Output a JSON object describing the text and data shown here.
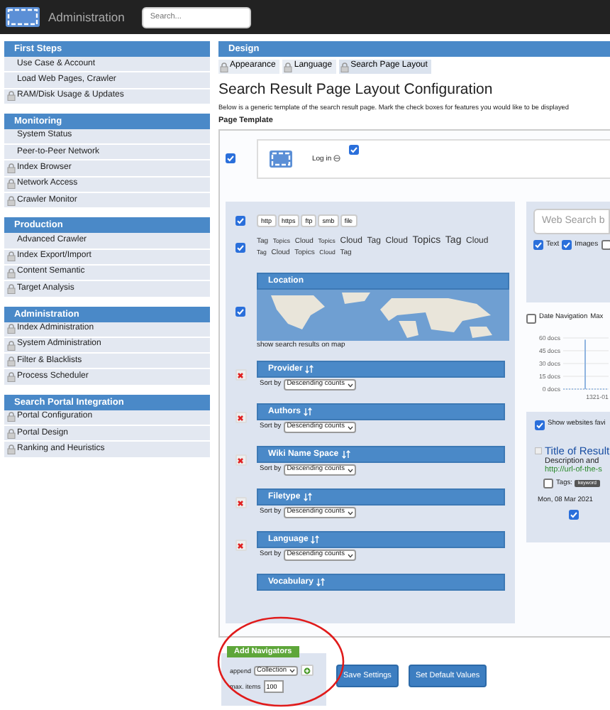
{
  "navbar": {
    "title": "Administration",
    "search": {
      "placeholder": "Search..."
    }
  },
  "sidebar": {
    "groups": [
      {
        "title": "First Steps",
        "items": [
          {
            "label": "Use Case & Account",
            "locked": false
          },
          {
            "label": "Load Web Pages, Crawler",
            "locked": false
          },
          {
            "label": "RAM/Disk Usage & Updates",
            "locked": true
          }
        ]
      },
      {
        "title": "Monitoring",
        "items": [
          {
            "label": "System Status",
            "locked": false
          },
          {
            "label": "Peer-to-Peer Network",
            "locked": false
          },
          {
            "label": "Index Browser",
            "locked": true
          },
          {
            "label": "Network Access",
            "locked": true
          },
          {
            "label": "Crawler Monitor",
            "locked": true
          }
        ]
      },
      {
        "title": "Production",
        "items": [
          {
            "label": "Advanced Crawler",
            "locked": false
          },
          {
            "label": "Index Export/Import",
            "locked": true
          },
          {
            "label": "Content Semantic",
            "locked": true
          },
          {
            "label": "Target Analysis",
            "locked": true
          }
        ]
      },
      {
        "title": "Administration",
        "items": [
          {
            "label": "Index Administration",
            "locked": true
          },
          {
            "label": "System Administration",
            "locked": true
          },
          {
            "label": "Filter & Blacklists",
            "locked": true
          },
          {
            "label": "Process Scheduler",
            "locked": true
          }
        ]
      },
      {
        "title": "Search Portal Integration",
        "items": [
          {
            "label": "Portal Configuration",
            "locked": true
          },
          {
            "label": "Portal Design",
            "locked": true
          },
          {
            "label": "Ranking and Heuristics",
            "locked": true
          }
        ]
      }
    ]
  },
  "design": {
    "header": "Design",
    "tabs": [
      {
        "label": "Appearance",
        "selected": false
      },
      {
        "label": "Language",
        "selected": false
      },
      {
        "label": "Search Page Layout",
        "selected": true
      }
    ],
    "title": "Search Result Page Layout Configuration",
    "description": "Below is a generic template of the search result page. Mark the check boxes for features you would like to be displayed",
    "template_label": "Page Template",
    "template": {
      "header_checked": true,
      "login": "Log in",
      "login_checked": true,
      "protocols": {
        "checked": true,
        "buttons": [
          "http",
          "https",
          "ftp",
          "smb",
          "file"
        ]
      },
      "tag_cloud": {
        "checked": true,
        "words": [
          {
            "text": "Tag",
            "kind": "small"
          },
          {
            "text": "Topics",
            "kind": "tiny"
          },
          {
            "text": "Cloud",
            "kind": "small"
          },
          {
            "text": "Topics",
            "kind": "tiny"
          },
          {
            "text": "Cloud",
            "kind": "medium"
          },
          {
            "text": "Tag",
            "kind": "medium"
          },
          {
            "text": "Cloud",
            "kind": "medium"
          },
          {
            "text": "Topics",
            "kind": "large"
          },
          {
            "text": "Tag",
            "kind": "large"
          },
          {
            "text": "Cloud",
            "kind": "medium"
          },
          {
            "text": "Tag",
            "kind": "tiny"
          },
          {
            "text": "Cloud",
            "kind": "small"
          },
          {
            "text": "Topics",
            "kind": "small"
          },
          {
            "text": "Cloud",
            "kind": "tiny"
          },
          {
            "text": "Tag",
            "kind": "small"
          }
        ]
      },
      "location": {
        "checked": true,
        "title": "Location",
        "caption": "show search results on map"
      },
      "navigators": [
        {
          "title": "Provider",
          "removable": true,
          "sort_label": "Sort by",
          "sort_value": "Descending counts"
        },
        {
          "title": "Authors",
          "removable": true,
          "sort_label": "Sort by",
          "sort_value": "Descending counts"
        },
        {
          "title": "Wiki Name Space",
          "removable": true,
          "sort_label": "Sort by",
          "sort_value": "Descending counts"
        },
        {
          "title": "Filetype",
          "removable": true,
          "sort_label": "Sort by",
          "sort_value": "Descending counts"
        },
        {
          "title": "Language",
          "removable": true,
          "sort_label": "Sort by",
          "sort_value": "Descending counts"
        },
        {
          "title": "Vocabulary",
          "removable": false
        }
      ],
      "search_panel": {
        "placeholder": "Web Search b",
        "options": [
          {
            "label": "Text",
            "checked": true
          },
          {
            "label": "Images",
            "checked": true
          },
          {
            "checked": false
          }
        ]
      },
      "date_nav": {
        "label": "Date Navigation",
        "checked": false,
        "extra": "Max"
      },
      "chart_data": {
        "type": "bar",
        "grid": true,
        "categories": [
          "1321-01"
        ],
        "values": [
          58
        ],
        "ylim": [
          0,
          60
        ],
        "yticks": [
          {
            "value": 0,
            "label": "0 docs"
          },
          {
            "value": 15,
            "label": "15 docs"
          },
          {
            "value": 30,
            "label": "30 docs"
          },
          {
            "value": 45,
            "label": "45 docs"
          },
          {
            "value": 60,
            "label": "60 docs"
          }
        ]
      },
      "result": {
        "favicon_label": "Show websites favi",
        "favicon_checked": true,
        "title": "Title of Result",
        "description": "Description and",
        "url": "http://url-of-the-s",
        "tags_label": "Tags:",
        "tags_checked": false,
        "tags": [
          "keyword"
        ],
        "date": "Mon, 08 Mar 2021",
        "date_checked": true
      }
    },
    "add_navigators": {
      "title": "Add Navigators",
      "append_label": "append",
      "append_value": "Collection",
      "max_label": "max. items",
      "max_value": "100"
    },
    "buttons": [
      "Save Settings",
      "Set Default Values"
    ]
  }
}
